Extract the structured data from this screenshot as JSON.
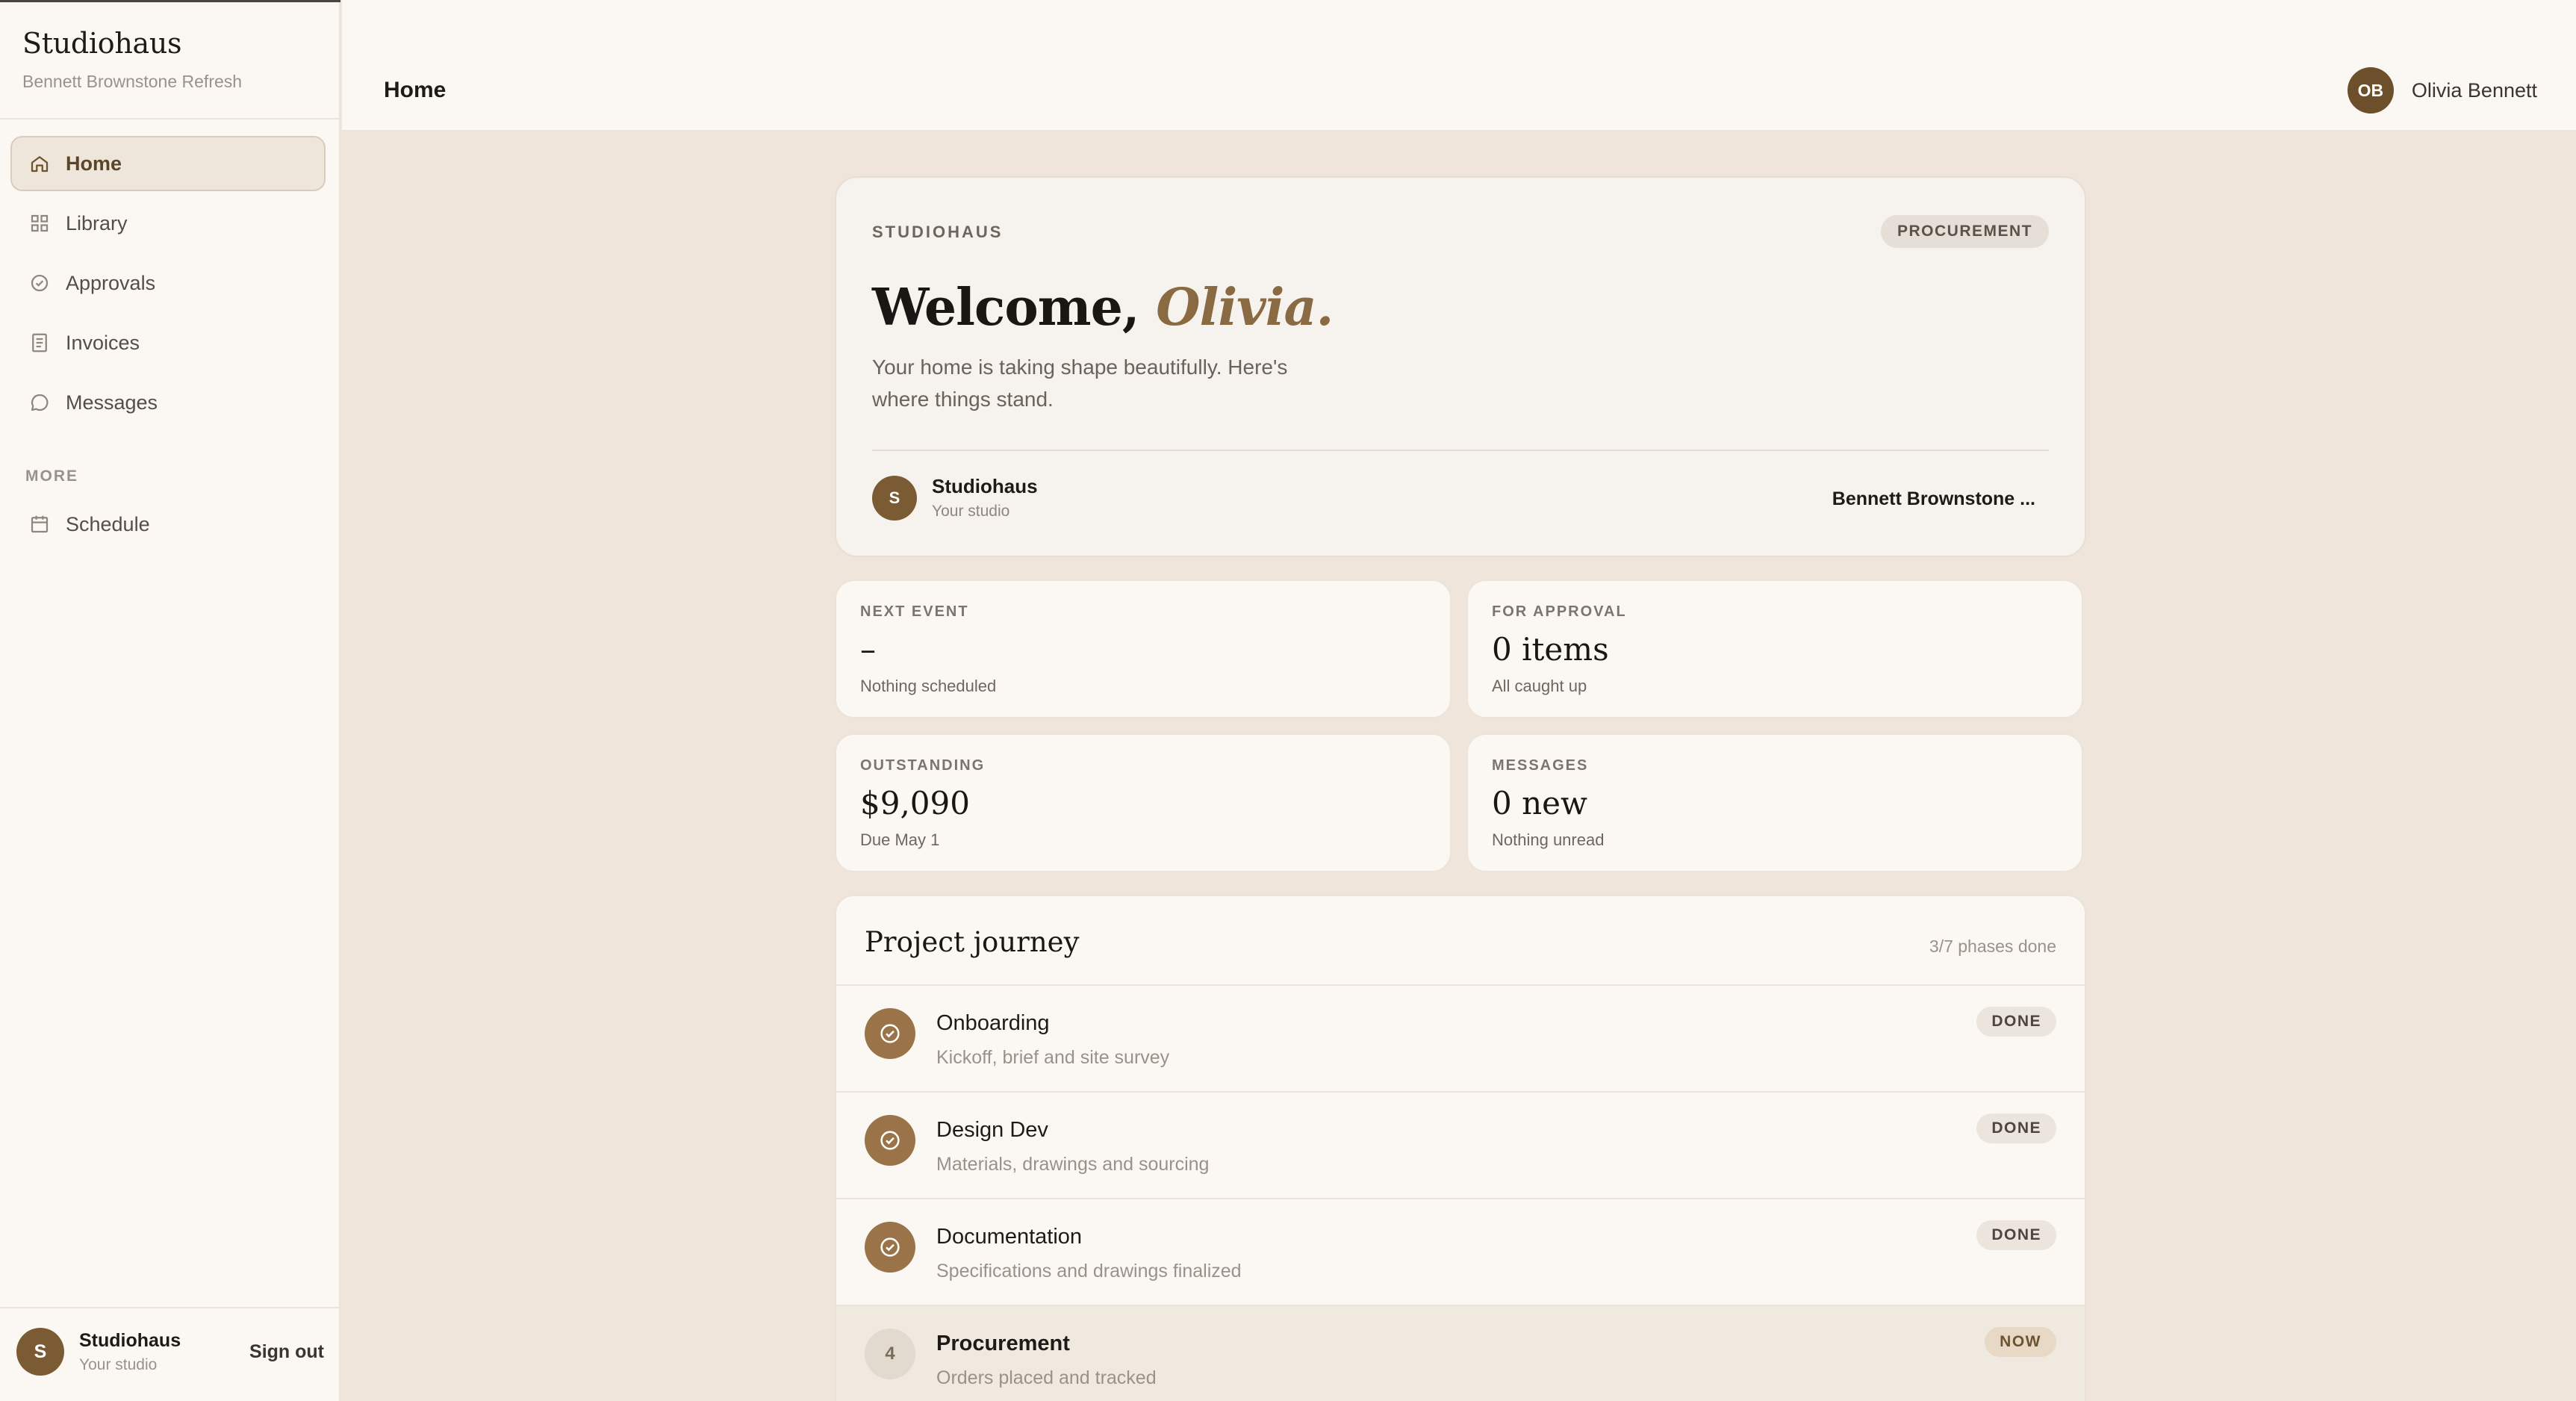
{
  "sidebar": {
    "brand": "Studiohaus",
    "project": "Bennett Brownstone Refresh",
    "items": [
      {
        "label": "Home",
        "icon": "home-icon"
      },
      {
        "label": "Library",
        "icon": "grid-icon"
      },
      {
        "label": "Approvals",
        "icon": "check-circle-icon"
      },
      {
        "label": "Invoices",
        "icon": "document-icon"
      },
      {
        "label": "Messages",
        "icon": "chat-bubble-icon"
      }
    ],
    "more_label": "MORE",
    "more_items": [
      {
        "label": "Schedule",
        "icon": "calendar-icon"
      }
    ],
    "footer": {
      "avatar": "S",
      "name": "Studiohaus",
      "subtitle": "Your studio",
      "signout": "Sign out"
    }
  },
  "header": {
    "title": "Home",
    "user_initials": "OB",
    "user_name": "Olivia Bennett"
  },
  "welcome": {
    "eyebrow": "STUDIOHAUS",
    "chip": "PROCUREMENT",
    "greeting": "Welcome,",
    "name": "Olivia.",
    "body": "Your home is taking shape beautifully. Here's where things stand.",
    "studio_avatar": "S",
    "studio_name": "Studiohaus",
    "studio_sub": "Your studio",
    "project": "Bennett Brownstone ..."
  },
  "stats": [
    {
      "label": "NEXT EVENT",
      "value": "–",
      "sub": "Nothing scheduled"
    },
    {
      "label": "FOR APPROVAL",
      "value": "0 items",
      "sub": "All caught up"
    },
    {
      "label": "OUTSTANDING",
      "value": "$9,090",
      "sub": "Due May 1"
    },
    {
      "label": "MESSAGES",
      "value": "0 new",
      "sub": "Nothing unread"
    }
  ],
  "journey": {
    "title": "Project journey",
    "count": "3/7 phases done",
    "phases": [
      {
        "title": "Onboarding",
        "sub": "Kickoff, brief and site survey",
        "badge": "DONE"
      },
      {
        "title": "Design Dev",
        "sub": "Materials, drawings and sourcing",
        "badge": "DONE"
      },
      {
        "title": "Documentation",
        "sub": "Specifications and drawings finalized",
        "badge": "DONE"
      },
      {
        "title": "Procurement",
        "sub": "Orders placed and tracked",
        "badge": "NOW",
        "number": "4"
      }
    ]
  },
  "colors": {
    "accent": "#8a6a43",
    "avatar": "#7a5b33",
    "background": "#efe5da",
    "panel": "#fbf8f4"
  }
}
